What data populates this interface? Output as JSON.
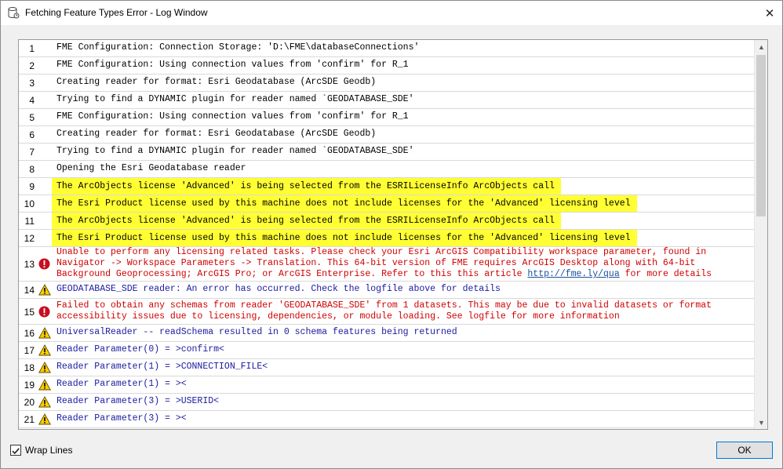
{
  "window": {
    "title": "Fetching Feature Types Error - Log Window",
    "close_glyph": "✕"
  },
  "log": {
    "rows": [
      {
        "n": "1",
        "kind": "info",
        "icon": "none",
        "text": "FME Configuration: Connection Storage: 'D:\\FME\\databaseConnections'"
      },
      {
        "n": "2",
        "kind": "info",
        "icon": "none",
        "text": "FME Configuration: Using connection values from 'confirm' for R_1"
      },
      {
        "n": "3",
        "kind": "info",
        "icon": "none",
        "text": "Creating reader for format: Esri Geodatabase (ArcSDE Geodb)"
      },
      {
        "n": "4",
        "kind": "info",
        "icon": "none",
        "text": "Trying to find a DYNAMIC plugin for reader named `GEODATABASE_SDE'"
      },
      {
        "n": "5",
        "kind": "info",
        "icon": "none",
        "text": "FME Configuration: Using connection values from 'confirm' for R_1"
      },
      {
        "n": "6",
        "kind": "info",
        "icon": "none",
        "text": "Creating reader for format: Esri Geodatabase (ArcSDE Geodb)"
      },
      {
        "n": "7",
        "kind": "info",
        "icon": "none",
        "text": "Trying to find a DYNAMIC plugin for reader named `GEODATABASE_SDE'"
      },
      {
        "n": "8",
        "kind": "info",
        "icon": "none",
        "text": "Opening the Esri Geodatabase reader"
      },
      {
        "n": "9",
        "kind": "hl",
        "icon": "none",
        "text": "The ArcObjects license 'Advanced' is being selected from the ESRILicenseInfo ArcObjects call"
      },
      {
        "n": "10",
        "kind": "hl",
        "icon": "none",
        "text": "The Esri Product license used by this machine does not include licenses for the 'Advanced' licensing level"
      },
      {
        "n": "11",
        "kind": "hl",
        "icon": "none",
        "text": "The ArcObjects license 'Advanced' is being selected from the ESRILicenseInfo ArcObjects call"
      },
      {
        "n": "12",
        "kind": "hl",
        "icon": "none",
        "text": "The Esri Product license used by this machine does not include licenses for the 'Advanced' licensing level"
      },
      {
        "n": "13",
        "kind": "err",
        "icon": "error",
        "text": "Unable to perform any licensing related tasks. Please check your Esri ArcGIS Compatibility workspace parameter, found in\nNavigator -> Workspace Parameters -> Translation. This 64-bit version of FME requires ArcGIS Desktop along with 64-bit\nBackground Geoprocessing; ArcGIS Pro; or ArcGIS Enterprise. Refer to this this article ",
        "link": "http://fme.ly/qua",
        "after": " for more details"
      },
      {
        "n": "14",
        "kind": "warn",
        "icon": "warning",
        "text": "GEODATABASE_SDE reader: An error has occurred. Check the logfile above for details"
      },
      {
        "n": "15",
        "kind": "err",
        "icon": "error",
        "text": "Failed to obtain any schemas from reader 'GEODATABASE_SDE' from 1 datasets. This may be due to invalid datasets or format\naccessibility issues due to licensing, dependencies, or module loading. See logfile for more information"
      },
      {
        "n": "16",
        "kind": "warn",
        "icon": "warning",
        "text": "UniversalReader -- readSchema resulted in 0 schema features being returned"
      },
      {
        "n": "17",
        "kind": "warn",
        "icon": "warning",
        "text": "Reader Parameter(0) = >confirm<"
      },
      {
        "n": "18",
        "kind": "warn",
        "icon": "warning",
        "text": "Reader Parameter(1) = >CONNECTION_FILE<"
      },
      {
        "n": "19",
        "kind": "warn",
        "icon": "warning",
        "text": "Reader Parameter(1) = ><"
      },
      {
        "n": "20",
        "kind": "warn",
        "icon": "warning",
        "text": "Reader Parameter(3) = >USERID<"
      },
      {
        "n": "21",
        "kind": "warn",
        "icon": "warning",
        "text": "Reader Parameter(3) = ><"
      }
    ]
  },
  "scrollbar": {
    "up_glyph": "▲",
    "down_glyph": "▼"
  },
  "footer": {
    "wrap_label": "Wrap Lines",
    "wrap_checked": true,
    "ok_label": "OK"
  },
  "colors": {
    "highlight": "#ffff33",
    "error_text": "#d00000",
    "warning_text": "#1a1aa0",
    "button_border": "#0078d7"
  }
}
